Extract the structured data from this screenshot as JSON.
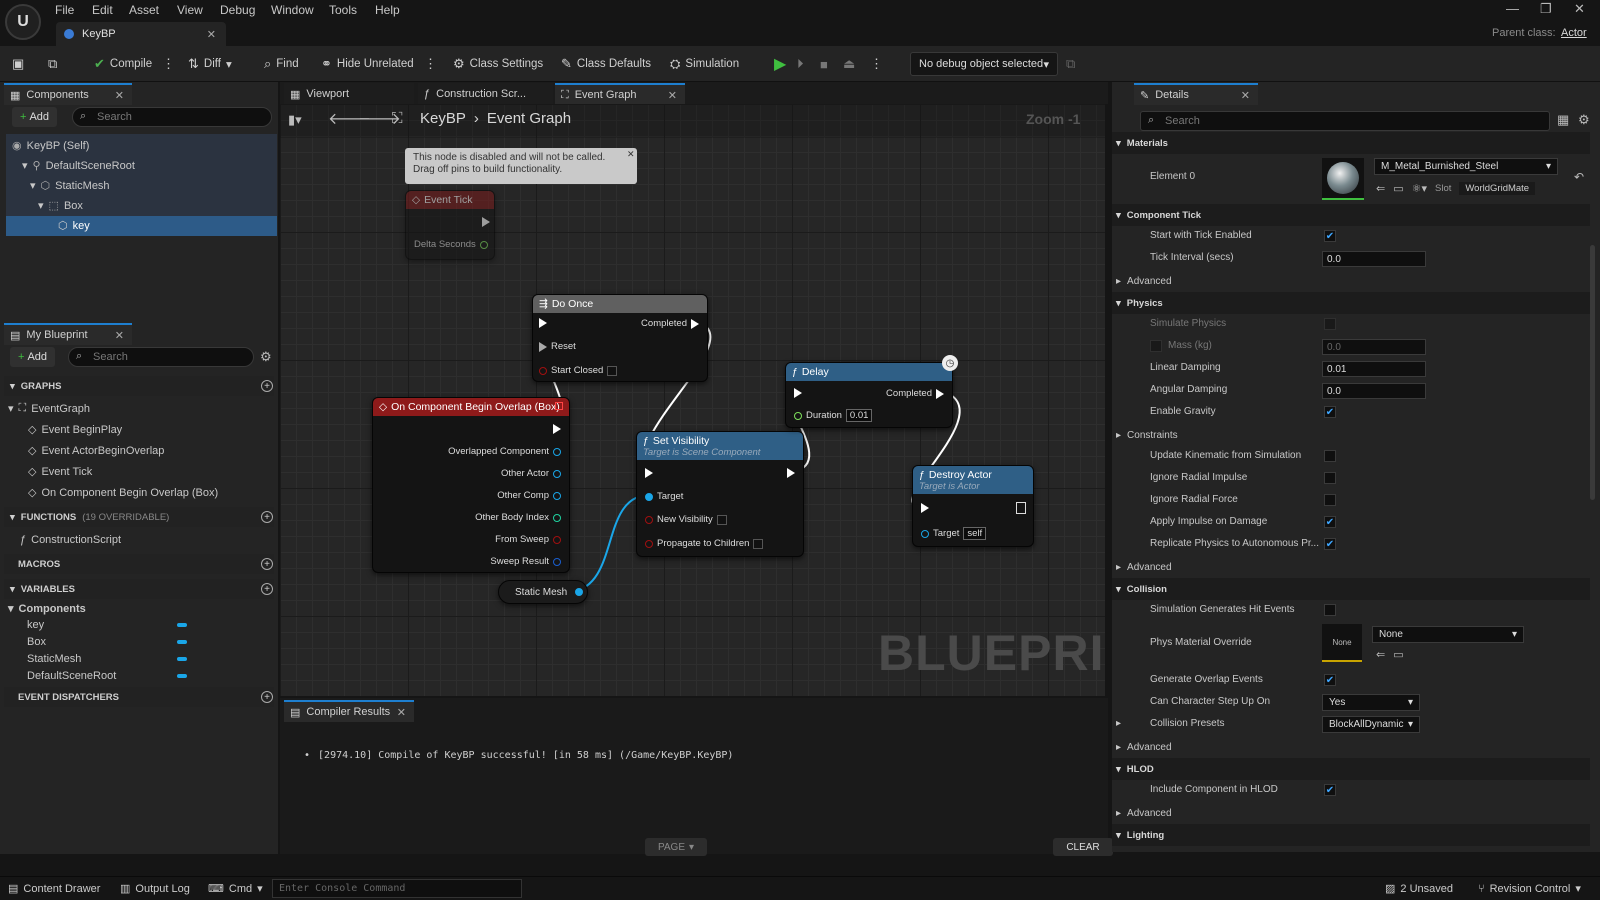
{
  "menu": [
    "File",
    "Edit",
    "Asset",
    "View",
    "Debug",
    "Window",
    "Tools",
    "Help"
  ],
  "tab": {
    "title": "KeyBP"
  },
  "parent_class": {
    "label": "Parent class:",
    "value": "Actor"
  },
  "toolbar": {
    "compile": "Compile",
    "diff": "Diff",
    "find": "Find",
    "hide_unrelated": "Hide Unrelated",
    "class_settings": "Class Settings",
    "class_defaults": "Class Defaults",
    "simulation": "Simulation",
    "debug_object": "No debug object selected"
  },
  "components_panel": {
    "title": "Components",
    "add": "Add",
    "search_placeholder": "Search",
    "tree": [
      "KeyBP (Self)",
      "DefaultSceneRoot",
      "StaticMesh",
      "Box",
      "key"
    ]
  },
  "my_blueprint": {
    "title": "My Blueprint",
    "add": "Add",
    "search_placeholder": "Search",
    "graphs_label": "GRAPHS",
    "event_graph": "EventGraph",
    "events": [
      "Event BeginPlay",
      "Event ActorBeginOverlap",
      "Event Tick",
      "On Component Begin Overlap (Box)"
    ],
    "functions_label": "FUNCTIONS",
    "functions_count": "(19 OVERRIDABLE)",
    "construction_script": "ConstructionScript",
    "macros_label": "MACROS",
    "variables_label": "VARIABLES",
    "components_label": "Components",
    "variables": [
      "key",
      "Box",
      "StaticMesh",
      "DefaultSceneRoot"
    ],
    "dispatchers_label": "EVENT DISPATCHERS"
  },
  "editor_tabs": [
    "Viewport",
    "Construction Scr...",
    "Event Graph"
  ],
  "breadcrumb": {
    "root": "KeyBP",
    "current": "Event Graph",
    "zoom": "Zoom -1"
  },
  "watermark": "BLUEPRINT",
  "nodes": {
    "disabled_note": "This node is disabled and will not be called. Drag off pins to build functionality.",
    "event_tick": {
      "title": "Event Tick",
      "pin": "Delta Seconds"
    },
    "do_once": {
      "title": "Do Once",
      "completed": "Completed",
      "reset": "Reset",
      "start_closed": "Start Closed"
    },
    "overlap": {
      "title": "On Component Begin Overlap (Box)",
      "pins": [
        "Overlapped Component",
        "Other Actor",
        "Other Comp",
        "Other Body Index",
        "From Sweep",
        "Sweep Result"
      ]
    },
    "set_visibility": {
      "title": "Set Visibility",
      "subtitle": "Target is Scene Component",
      "target": "Target",
      "new_visibility": "New Visibility",
      "propagate": "Propagate to Children"
    },
    "delay": {
      "title": "Delay",
      "completed": "Completed",
      "duration": "Duration",
      "duration_value": "0.01"
    },
    "destroy": {
      "title": "Destroy Actor",
      "subtitle": "Target is Actor",
      "target": "Target",
      "target_value": "self"
    },
    "static_mesh": "Static Mesh"
  },
  "compiler": {
    "title": "Compiler Results",
    "message": "[2974.10] Compile of KeyBP successful! [in 58 ms] (/Game/KeyBP.KeyBP)",
    "page": "PAGE",
    "clear": "CLEAR"
  },
  "details": {
    "title": "Details",
    "search_placeholder": "Search",
    "materials": "Materials",
    "element0": "Element 0",
    "material_name": "M_Metal_Burnished_Steel",
    "slot_label": "Slot",
    "slot_value": "WorldGridMate",
    "component_tick": "Component Tick",
    "start_tick": "Start with Tick Enabled",
    "tick_interval": "Tick Interval (secs)",
    "tick_interval_value": "0.0",
    "advanced": "Advanced",
    "physics": "Physics",
    "simulate": "Simulate Physics",
    "mass": "Mass (kg)",
    "mass_value": "0.0",
    "linear_damping": "Linear Damping",
    "linear_damping_value": "0.01",
    "angular_damping": "Angular Damping",
    "angular_damping_value": "0.0",
    "enable_gravity": "Enable Gravity",
    "constraints": "Constraints",
    "update_kinematic": "Update Kinematic from Simulation",
    "ignore_radial_impulse": "Ignore Radial Impulse",
    "ignore_radial_force": "Ignore Radial Force",
    "apply_impulse": "Apply Impulse on Damage",
    "replicate_physics": "Replicate Physics to Autonomous Pr...",
    "collision": "Collision",
    "sim_hit": "Simulation Generates Hit Events",
    "phys_material": "Phys Material Override",
    "phys_thumb": "None",
    "phys_value": "None",
    "gen_overlap": "Generate Overlap Events",
    "step_up": "Can Character Step Up On",
    "step_up_value": "Yes",
    "presets": "Collision Presets",
    "presets_value": "BlockAllDynamic",
    "hlod": "HLOD",
    "include_hlod": "Include Component in HLOD",
    "lighting": "Lighting"
  },
  "statusbar": {
    "content_drawer": "Content Drawer",
    "output_log": "Output Log",
    "cmd": "Cmd",
    "console_placeholder": "Enter Console Command",
    "unsaved": "2 Unsaved",
    "revision": "Revision Control"
  }
}
